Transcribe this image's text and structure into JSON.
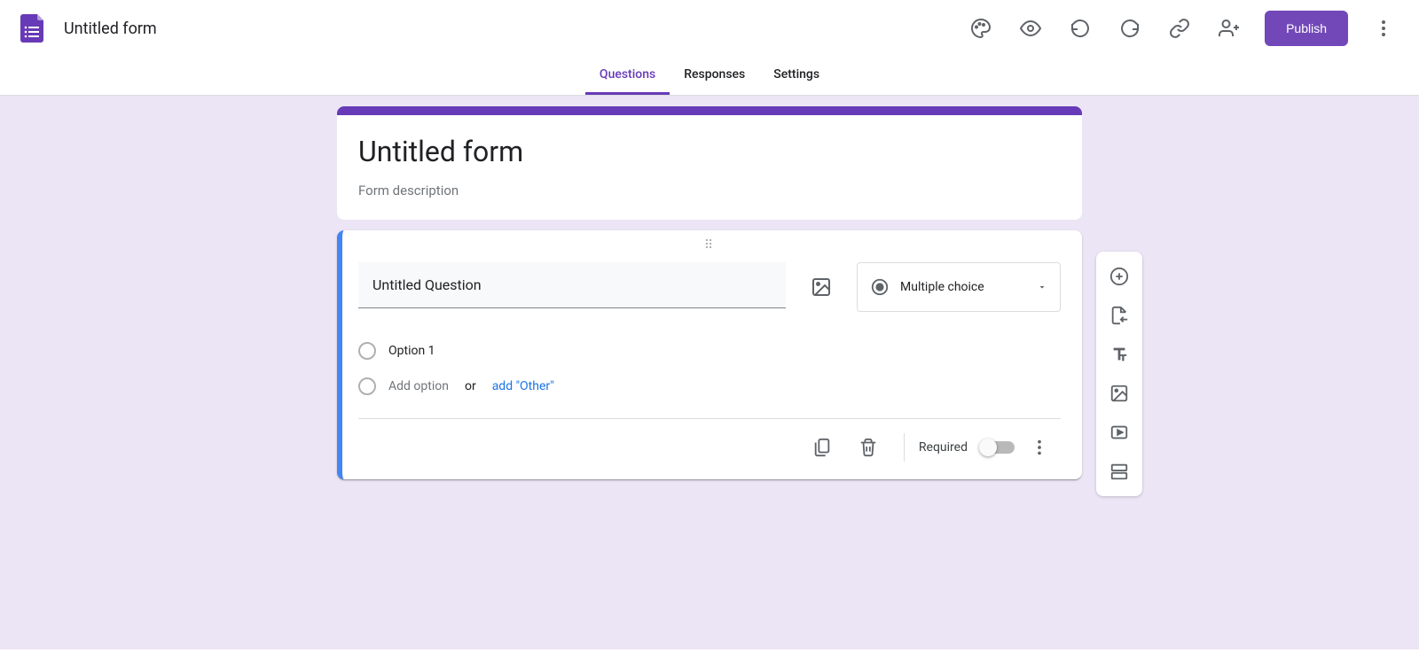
{
  "header": {
    "doc_title": "Untitled form",
    "publish_label": "Publish"
  },
  "tabs": {
    "questions": "Questions",
    "responses": "Responses",
    "settings": "Settings"
  },
  "form": {
    "title": "Untitled form",
    "description_placeholder": "Form description"
  },
  "question": {
    "title": "Untitled Question",
    "type_label": "Multiple choice",
    "option1": "Option 1",
    "add_option": "Add option",
    "or": "or",
    "add_other": "add \"Other\"",
    "required_label": "Required"
  }
}
